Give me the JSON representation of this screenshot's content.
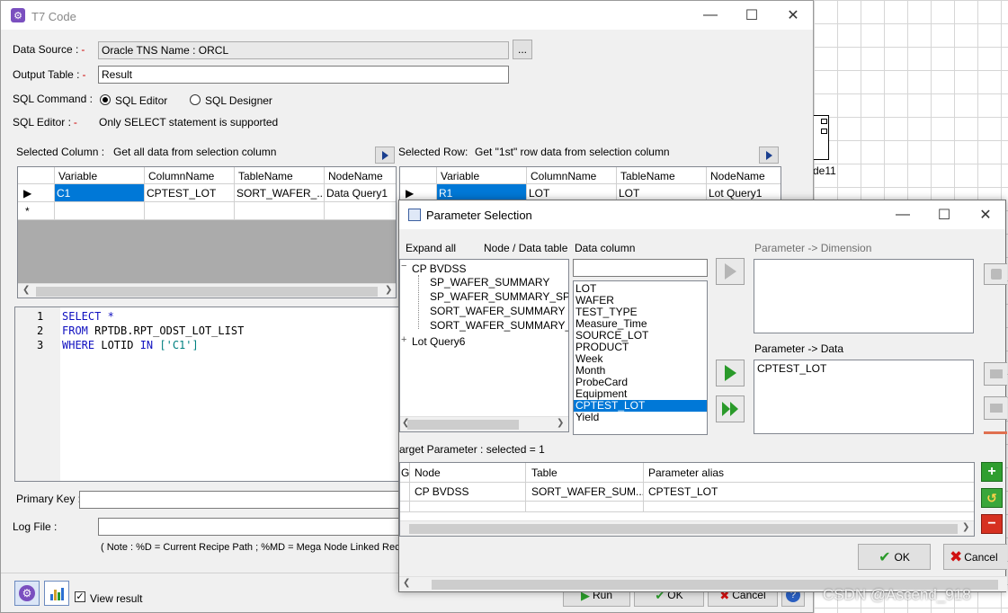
{
  "main": {
    "title": "T7 Code",
    "data_source_label": "Data Source :",
    "data_source_value": "Oracle TNS Name : ORCL",
    "browse_label": "...",
    "output_table_label": "Output Table :",
    "output_table_value": "Result",
    "sql_command_label": "SQL Command :",
    "sql_editor_option": "SQL Editor",
    "sql_designer_option": "SQL Designer",
    "sql_editor_label": "SQL Editor :",
    "sql_editor_note": "Only SELECT statement is supported",
    "required_mark": "-",
    "selected_column_label": "Selected Column :",
    "selected_column_note": "Get all data from selection column",
    "selected_row_label": "Selected Row:",
    "selected_row_note": "Get \"1st\" row data from selection column",
    "left_grid": {
      "headers": [
        "Variable",
        "ColumnName",
        "TableName",
        "NodeName"
      ],
      "row": [
        "C1",
        "CPTEST_LOT",
        "SORT_WAFER_...",
        "Data Query1"
      ],
      "new_row_marker": "*"
    },
    "right_grid": {
      "headers": [
        "Variable",
        "ColumnName",
        "TableName",
        "NodeName"
      ],
      "row": [
        "R1",
        "LOT",
        "LOT",
        "Lot Query1"
      ]
    },
    "code": {
      "line_numbers": [
        "1",
        "2",
        "3"
      ],
      "line1_kw": "SELECT",
      "line1_rest": " *",
      "line2_kw": "FROM",
      "line2_rest": " RPTDB.RPT_ODST_LOT_LIST",
      "line3_kw": "WHERE",
      "line3_mid": " LOTID ",
      "line3_kw2": "IN",
      "line3_str": " ['C1']"
    },
    "primary_key_label": "Primary Key :",
    "log_file_label": "Log File :",
    "note": "( Note : %D = Current Recipe Path ; %MD = Mega Node Linked Rec",
    "view_result_label": "View result",
    "run_label": "Run",
    "ok_label": "OK",
    "cancel_label": "Cancel"
  },
  "dialog": {
    "title": "Parameter Selection",
    "expand_all_label": "Expand all",
    "node_table_label": "Node / Data table",
    "data_column_label": "Data column",
    "param_dimension_label": "Parameter -> Dimension",
    "param_data_label": "Parameter -> Data",
    "param_data_value": "CPTEST_LOT",
    "tree": {
      "root1": "CP BVDSS",
      "children": [
        "SP_WAFER_SUMMARY",
        "SP_WAFER_SUMMARY_SPEC",
        "SORT_WAFER_SUMMARY",
        "SORT_WAFER_SUMMARY_PA"
      ],
      "root2": "Lot Query6",
      "expander_open": "−",
      "expander_closed": "+"
    },
    "data_columns": [
      "LOT",
      "WAFER",
      "TEST_TYPE",
      "Measure_Time",
      "SOURCE_LOT",
      "PRODUCT",
      "Week",
      "Month",
      "ProbeCard",
      "Equipment",
      "CPTEST_LOT",
      "Yield"
    ],
    "selected_column": "CPTEST_LOT",
    "target_label": "arget Parameter : selected = 1",
    "target_grid": {
      "headers": [
        "G",
        "Node",
        "Table",
        "Parameter alias"
      ],
      "row": [
        "",
        "CP BVDSS",
        "SORT_WAFER_SUM...",
        "CPTEST_LOT"
      ]
    },
    "ok_label": "OK",
    "cancel_label": "Cancel"
  },
  "background": {
    "node_label": "de11",
    "watermark": "CSDN @Ascend_918"
  },
  "colors": {
    "selection": "#0078d7",
    "play_green": "#2a9a2a",
    "required_red": "#cc0000"
  }
}
